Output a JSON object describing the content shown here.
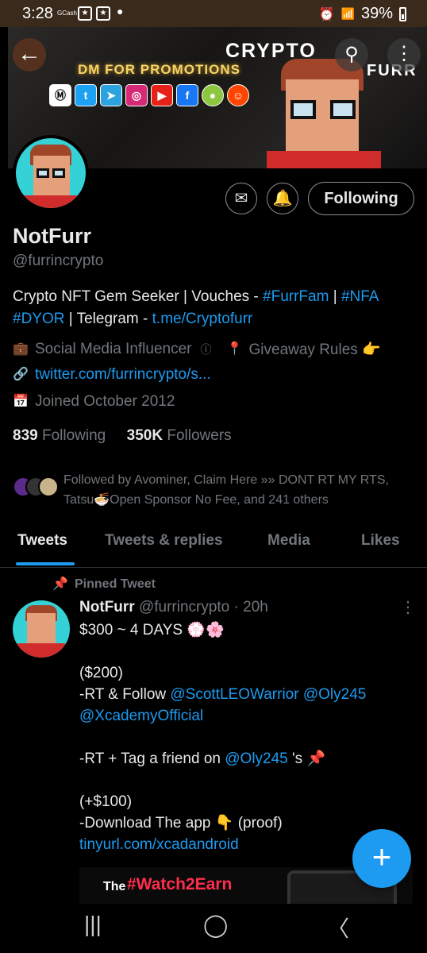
{
  "status_bar": {
    "time": "3:28",
    "gcash": "GCash",
    "battery": "39%"
  },
  "banner": {
    "promo": "DM FOR PROMOTIONS",
    "brand_line1": "CRYPTO",
    "brand_line2": "FURR",
    "social_icons": [
      "coinmarketcap-icon",
      "twitter-icon",
      "telegram-icon",
      "instagram-icon",
      "youtube-icon",
      "facebook-icon",
      "coingecko-icon",
      "reddit-icon"
    ]
  },
  "profile": {
    "name": "NotFurr",
    "handle": "@furrincrypto",
    "bio_text_1": "Crypto NFT Gem Seeker | Vouches - ",
    "bio_tag_1": "#FurrFam",
    "bio_sep": " | ",
    "bio_tag_2": "#NFA",
    "bio_tag_3": "#DYOR",
    "bio_text_2": " | Telegram - ",
    "bio_link": "t.me/Cryptofurr",
    "category": "Social Media Influencer",
    "location": "Giveaway Rules 👉",
    "website": "twitter.com/furrincrypto/s...",
    "joined": "Joined October 2012",
    "following_count": "839",
    "following_label": "Following",
    "followers_count": "350K",
    "followers_label": "Followers",
    "followed_by": "Followed by Avominer, Claim Here »» DONT RT MY RTS, Tatsu🍜Open Sponsor No Fee, and 241 others",
    "follow_button": "Following"
  },
  "tabs": [
    "Tweets",
    "Tweets & replies",
    "Media",
    "Likes"
  ],
  "pinned_label": "Pinned Tweet",
  "tweet": {
    "author": "NotFurr",
    "handle": "@furrincrypto",
    "time": "· 20h",
    "line1": "$300 ~ 4 DAYS 💮🌸",
    "line2": "($200)",
    "line3a": "-RT & Follow ",
    "mention1": "@ScottLEOWarrior",
    "mention2": "@Oly245",
    "mention3": "@XcademyOfficial",
    "line4a": "-RT + Tag a friend on ",
    "mention4": "@Oly245",
    "line4b": " 's 📌",
    "line5": "(+$100)",
    "line6": "-Download The app 👇 (proof)",
    "link": "tinyurl.com/xcadandroid",
    "media_word1": "The",
    "media_word2": "#Watch2Earn"
  },
  "colors": {
    "accent": "#1d9bf0",
    "background": "#000000",
    "muted": "#71767b"
  }
}
